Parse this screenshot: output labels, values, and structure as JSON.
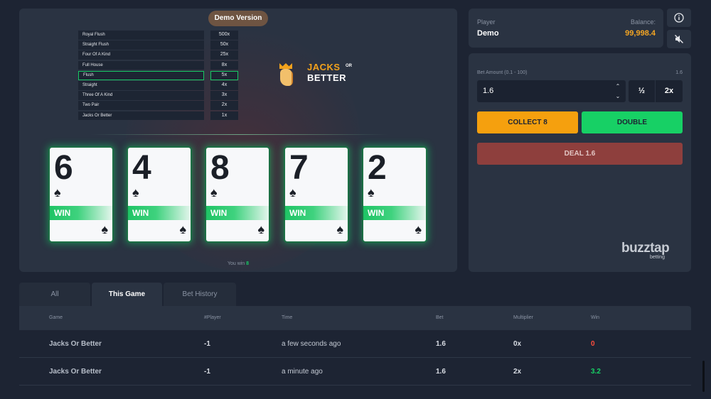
{
  "game": {
    "demo_badge": "Demo Version",
    "paytable": [
      {
        "name": "Royal Flush",
        "mult": "500x",
        "active": false
      },
      {
        "name": "Straight Flush",
        "mult": "50x",
        "active": false
      },
      {
        "name": "Four Of A Kind",
        "mult": "25x",
        "active": false
      },
      {
        "name": "Full House",
        "mult": "8x",
        "active": false
      },
      {
        "name": "Flush",
        "mult": "5x",
        "active": true
      },
      {
        "name": "Straight",
        "mult": "4x",
        "active": false
      },
      {
        "name": "Three Of A Kind",
        "mult": "3x",
        "active": false
      },
      {
        "name": "Two Pair",
        "mult": "2x",
        "active": false
      },
      {
        "name": "Jacks Or Better",
        "mult": "1x",
        "active": false
      }
    ],
    "logo": {
      "line1": "JACKS",
      "or": "OR",
      "line2": "BETTER"
    },
    "cards": [
      {
        "rank": "6",
        "suit": "♠",
        "win_label": "WIN"
      },
      {
        "rank": "4",
        "suit": "♠",
        "win_label": "WIN"
      },
      {
        "rank": "8",
        "suit": "♠",
        "win_label": "WIN"
      },
      {
        "rank": "7",
        "suit": "♠",
        "win_label": "WIN"
      },
      {
        "rank": "2",
        "suit": "♠",
        "win_label": "WIN"
      }
    ],
    "result": {
      "prefix": "You win",
      "amount": "8"
    }
  },
  "player": {
    "label": "Player",
    "name": "Demo",
    "balance_label": "Balance:",
    "balance_value": "99,998.4"
  },
  "icons": {
    "info": "info-icon",
    "mute": "mute-icon"
  },
  "bet": {
    "label": "Bet Amount (0.1 - 100)",
    "max_value": "1.6",
    "amount": "1.6",
    "half_label": "½",
    "double_label": "2x",
    "collect_label": "COLLECT 8",
    "double_button_label": "DOUBLE",
    "deal_label": "DEAL 1.6"
  },
  "brand": {
    "name": "buzztap",
    "sub": "betting"
  },
  "tabs": [
    {
      "label": "All",
      "active": false
    },
    {
      "label": "This Game",
      "active": true
    },
    {
      "label": "Bet History",
      "active": false
    }
  ],
  "history": {
    "columns": [
      "Game",
      "#Player",
      "Time",
      "Bet",
      "Multiplier",
      "Win"
    ],
    "rows": [
      {
        "game": "Jacks Or Better",
        "player": "-1",
        "time": "a few seconds ago",
        "bet": "1.6",
        "multiplier": "0x",
        "win": "0"
      },
      {
        "game": "Jacks Or Better",
        "player": "-1",
        "time": "a minute ago",
        "bet": "1.6",
        "multiplier": "2x",
        "win": "3.2"
      }
    ]
  },
  "colors": {
    "background": "#1d2433",
    "panel": "#2a3342",
    "accent_green": "#17d065",
    "accent_orange": "#f5a00e",
    "deal_red": "#8e3f3d",
    "balance_orange": "#f5a623"
  }
}
